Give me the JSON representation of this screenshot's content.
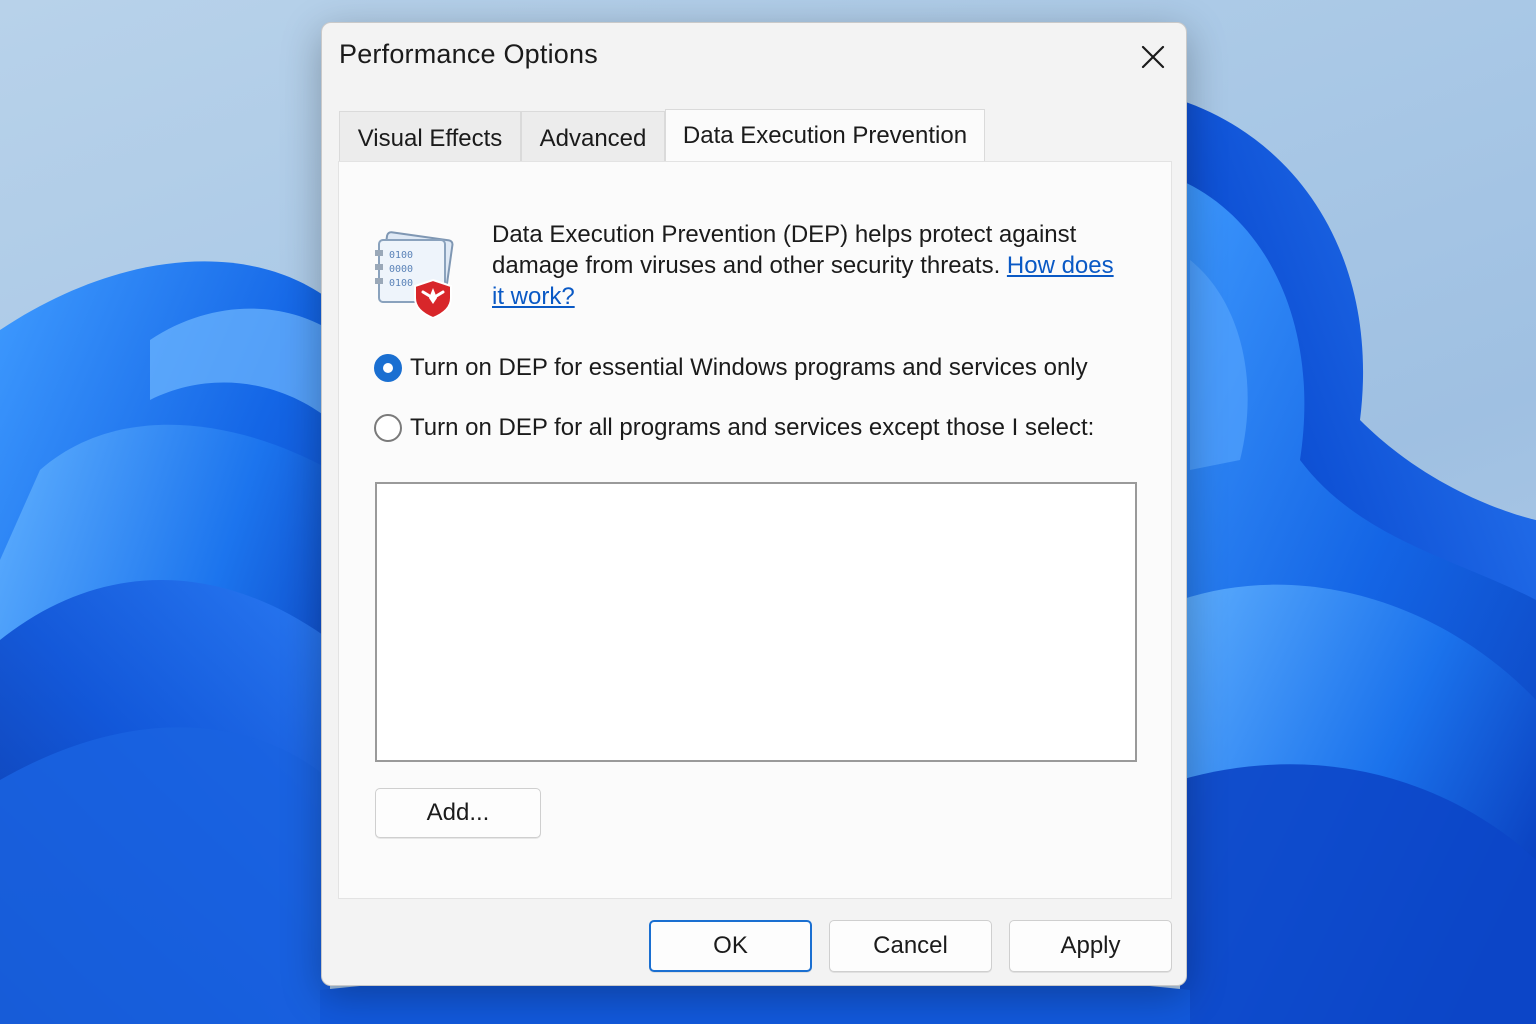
{
  "window": {
    "title": "Performance Options",
    "close_icon": "close-icon"
  },
  "tabs": [
    {
      "label": "Visual Effects",
      "active": false
    },
    {
      "label": "Advanced",
      "active": false
    },
    {
      "label": "Data Execution Prevention",
      "active": true
    }
  ],
  "dep_panel": {
    "icon": "dep-shield-document-icon",
    "description": "Data Execution Prevention (DEP) helps protect against damage from viruses and other security threats. ",
    "help_link": "How does it work?",
    "options": [
      {
        "label": "Turn on DEP for essential Windows programs and services only",
        "selected": true
      },
      {
        "label": "Turn on DEP for all programs and services except those I select:",
        "selected": false
      }
    ],
    "program_list": [],
    "add_label": "Add..."
  },
  "footer": {
    "ok_label": "OK",
    "cancel_label": "Cancel",
    "apply_label": "Apply"
  },
  "colors": {
    "accent": "#1a6fd1",
    "link": "#0a59c5",
    "dialog_bg": "#f3f3f3",
    "panel_bg": "#fbfbfb"
  }
}
